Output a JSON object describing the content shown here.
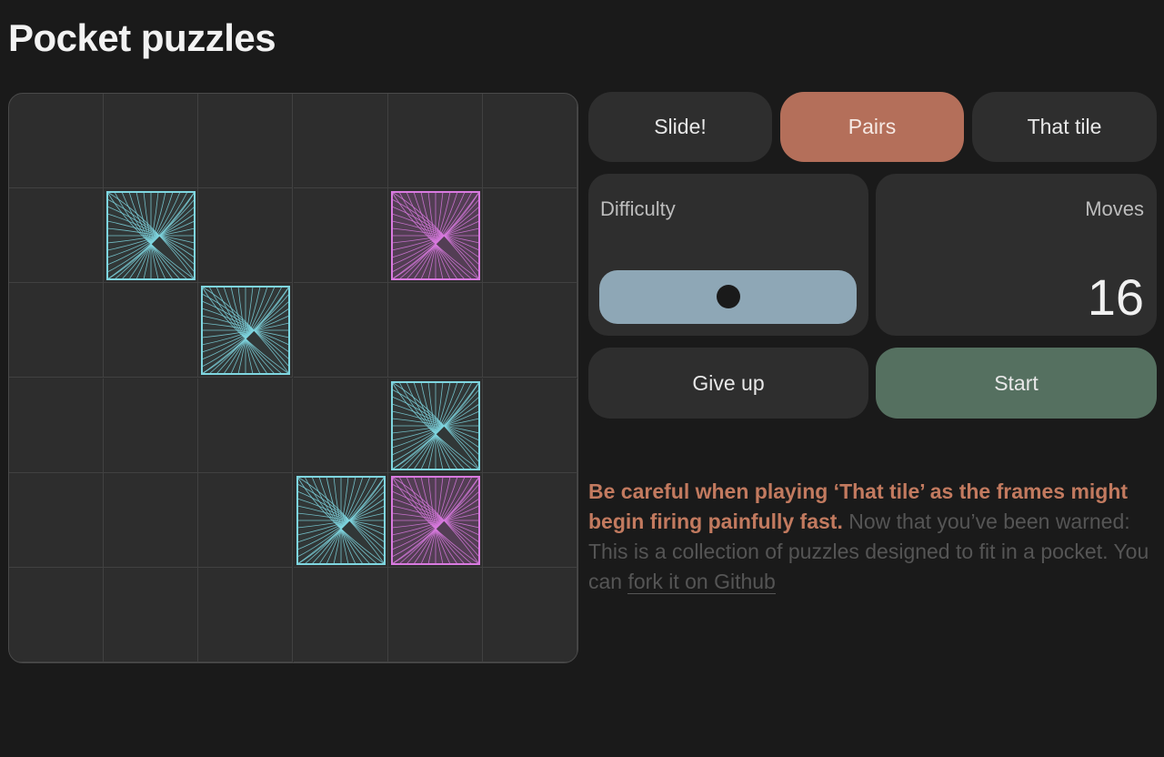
{
  "header": {
    "title": "Pocket puzzles"
  },
  "colors": {
    "background": "#1a1a1a",
    "panel": "#2e2e2e",
    "accent_active_tab": "#b46f5a",
    "start_button": "#557060",
    "slider": "#8ea7b6",
    "tile_cyan": "#7fd6e0",
    "tile_magenta": "#d97ae0",
    "warning": "#c27a5f"
  },
  "board": {
    "rows": 6,
    "cols": 6,
    "tiles": [
      {
        "row": 1,
        "col": 1,
        "color": "cyan"
      },
      {
        "row": 1,
        "col": 4,
        "color": "magenta"
      },
      {
        "row": 2,
        "col": 2,
        "color": "cyan"
      },
      {
        "row": 3,
        "col": 4,
        "color": "cyan"
      },
      {
        "row": 4,
        "col": 3,
        "color": "cyan"
      },
      {
        "row": 4,
        "col": 4,
        "color": "magenta"
      }
    ]
  },
  "tabs": [
    {
      "label": "Slide!",
      "active": false
    },
    {
      "label": "Pairs",
      "active": true
    },
    {
      "label": "That tile",
      "active": false
    }
  ],
  "difficulty": {
    "label": "Difficulty",
    "level": 0.5
  },
  "moves": {
    "label": "Moves",
    "value": "16"
  },
  "actions": {
    "give_up": "Give up",
    "start": "Start"
  },
  "info": {
    "warning": "Be careful when playing ‘That tile’ as the frames might begin firing painfully fast.",
    "text": " Now that you’ve been warned: This is a collection of puzzles designed to fit in a pocket. You can ",
    "link": "fork it on Github"
  }
}
